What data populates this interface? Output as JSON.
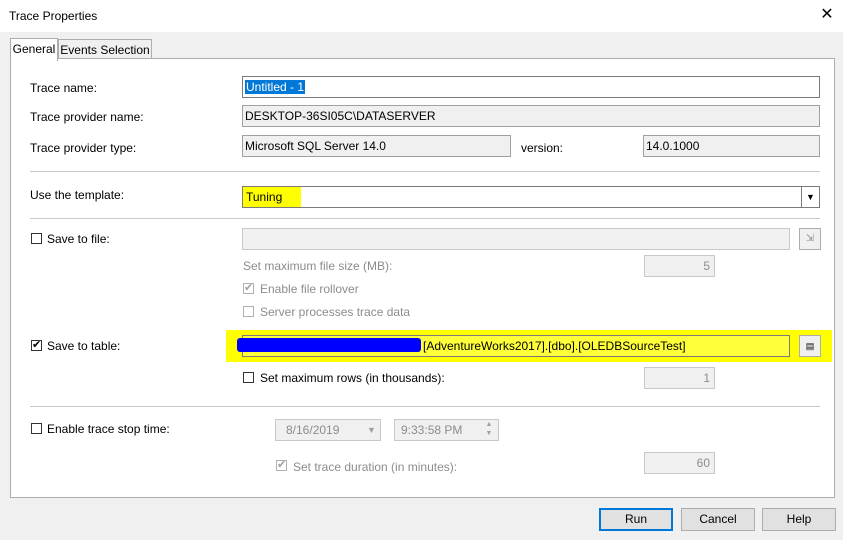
{
  "window": {
    "title": "Trace Properties",
    "close_glyph": "✕"
  },
  "tabs": [
    {
      "label": "General"
    },
    {
      "label": "Events Selection"
    }
  ],
  "general": {
    "trace_name_label": "Trace name:",
    "trace_name_value": "Untitled - 1",
    "provider_name_label": "Trace provider name:",
    "provider_name_value": "DESKTOP-36SI05C\\DATASERVER",
    "provider_type_label": "Trace provider type:",
    "provider_type_value": "Microsoft SQL Server 14.0",
    "version_label": "version:",
    "version_value": "14.0.1000",
    "template_label": "Use the template:",
    "template_value": "Tuning",
    "save_to_file_label": "Save to file:",
    "max_file_size_label": "Set maximum file size (MB):",
    "max_file_size_value": "5",
    "enable_rollover_label": "Enable file rollover",
    "server_processes_label": "Server processes trace data",
    "save_to_table_label": "Save to table:",
    "save_to_table_value": "[AdventureWorks2017].[dbo].[OLEDBSourceTest]",
    "max_rows_label": "Set maximum rows (in thousands):",
    "max_rows_value": "1",
    "stop_time_label": "Enable trace stop time:",
    "stop_date_value": "8/16/2019",
    "stop_time_value": "9:33:58 PM",
    "trace_duration_label": "Set trace duration (in minutes):",
    "trace_duration_value": "60"
  },
  "checkboxes": {
    "checked_glyph": "✔"
  },
  "buttons": {
    "run": "Run",
    "cancel": "Cancel",
    "help": "Help"
  },
  "colors": {
    "highlight": "#ffff00",
    "redaction": "#0000ff",
    "selection": "#0078d7"
  }
}
